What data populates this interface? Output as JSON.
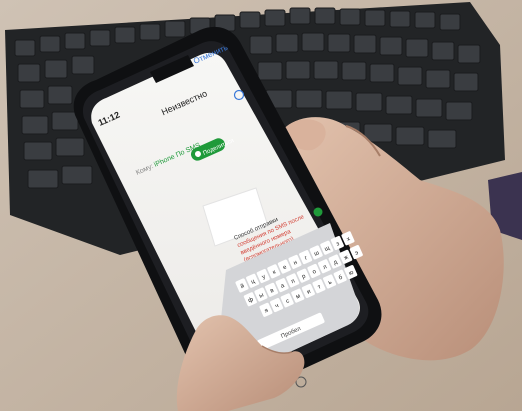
{
  "phone": {
    "time": "11:12",
    "title": "Неизвестно",
    "cancel": "Отменить",
    "to_label": "Кому:",
    "recipient": "iPhone По SMS",
    "save_button": "Поделиться",
    "message_lines": [
      "Способ отправки",
      "сообщения по SMS после",
      "введённого номера",
      "(вспомогательного)"
    ]
  },
  "keyboard": {
    "rows": [
      [
        "й",
        "ц",
        "у",
        "к",
        "е",
        "н",
        "г",
        "ш",
        "щ",
        "з",
        "х"
      ],
      [
        "ф",
        "ы",
        "в",
        "а",
        "п",
        "р",
        "о",
        "л",
        "д",
        "ж",
        "э"
      ],
      [
        "я",
        "ч",
        "с",
        "м",
        "и",
        "т",
        "ь",
        "б",
        "ю"
      ]
    ],
    "space_label": "Пробел"
  },
  "colors": {
    "accent": "#1f9a3a",
    "link": "#3a78d8",
    "text_red": "#d23b30"
  }
}
